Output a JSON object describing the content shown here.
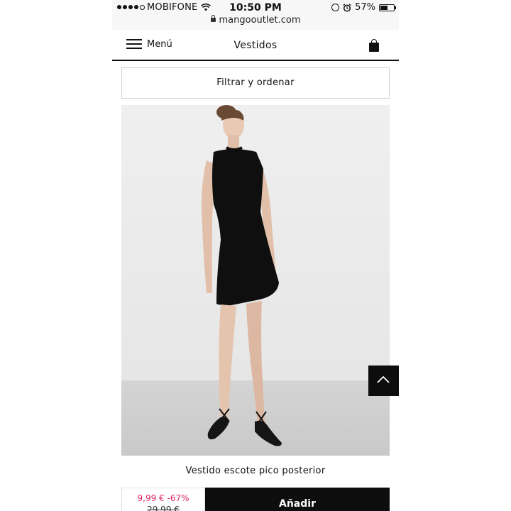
{
  "status_bar": {
    "carrier": "MOBIFONE",
    "signal_bars_filled": 4,
    "signal_bars_total": 5,
    "time": "10:50 PM",
    "battery": "57%",
    "battery_level": 0.57,
    "icons": [
      "wifi-icon",
      "rotation-lock-icon",
      "alarm-icon",
      "battery-icon"
    ]
  },
  "browser": {
    "url": "mangooutlet.com"
  },
  "header": {
    "menu_label": "Menú",
    "title": "Vestidos"
  },
  "filter": {
    "label": "Filtrar y ordenar"
  },
  "product": {
    "name": "Vestido escote pico posterior",
    "sale_price": "9,99 € -67%",
    "original_price": "29,99 €",
    "add_label": "Añadir",
    "image": "photo of model wearing black sleeveless dress and black lace-up flats"
  },
  "colors": {
    "accent_sale": "#e0245e",
    "button_dark": "#0d0d0d",
    "status_bar_bg": "#f7f7f7"
  }
}
